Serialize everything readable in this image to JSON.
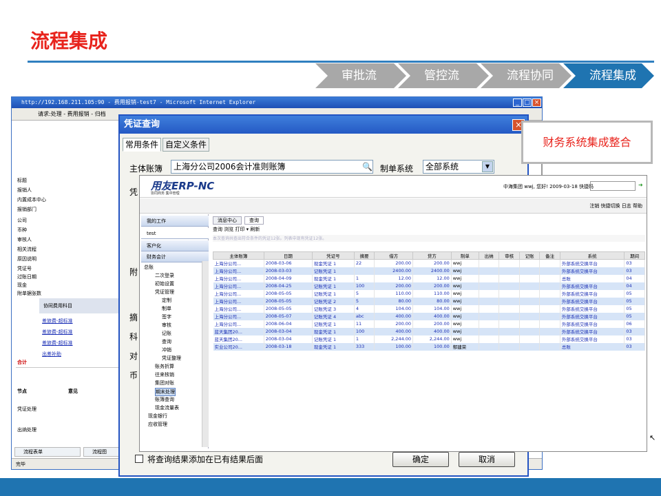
{
  "slide": {
    "title": "流程集成",
    "steps": [
      "审批流",
      "管控流",
      "流程协同",
      "流程集成"
    ],
    "callout": "财务系统集成整合"
  },
  "ie": {
    "title": "http://192.168.211.105:90 - 费用报销-test7 - Microsoft Internet Explorer",
    "toolbar": "请求:处理 - 费用报销 - 归档",
    "left_fields": [
      "标题",
      "报销人",
      "内置成本中心",
      "报销部门",
      "公司",
      "币种",
      "审核人",
      "相关流程",
      "原因说明",
      "凭证号",
      "过账日期",
      "现金",
      "附单据张数"
    ],
    "section_header": "协同费用科目",
    "section_links": [
      "差旅费-超标准",
      "差旅费-超标准",
      "差旅费-超标准",
      "出差补助"
    ],
    "total_label": "合计",
    "node_label": "节点",
    "opinion_label": "意见",
    "node_items": [
      "凭证处理",
      "出纳处理"
    ],
    "bottom_tabs": [
      "流程表单",
      "流程图"
    ],
    "status": "完毕"
  },
  "dialog": {
    "title": "凭证查询",
    "tabs": [
      "常用条件",
      "自定义条件"
    ],
    "ledger_label": "主体账簿",
    "ledger_value": "上海分公司2006会计准则账簿",
    "system_label": "制单系统",
    "system_value": "全部系统",
    "partial_labels": [
      "凭",
      "附",
      "摘",
      "科",
      "对",
      "币"
    ],
    "append_label": "将查询结果添加在已有结果后面",
    "ok_label": "确定",
    "cancel_label": "取消"
  },
  "erp": {
    "logo": "用友ERP-NC",
    "logo_sub": "协同商务   集中管理",
    "user_info": "中海集团 wwj, 您好! 2009-03-18   快捷码",
    "top_links": "注销  快捷切换  日志  帮助",
    "sidebar_headers": [
      "我的工作",
      "test",
      "客户化",
      "财务会计"
    ],
    "tree": [
      "总账",
      "二次登录",
      "初始设置",
      "凭证管理",
      "定制",
      "制单",
      "签字",
      "审核",
      "记账",
      "查询",
      "冲销",
      "凭证整理",
      "账务折算",
      "往来核销",
      "集团对账",
      "期末处理",
      "账簿查询",
      "现金流量表",
      "现金银行",
      "应收管理"
    ],
    "tabs": [
      "消息中心",
      "查询"
    ],
    "commands": "查询  浏览  打印 ▾  刷新",
    "info": "本次查询共查出符合条件的凭证12张。列表中现有凭证12张。",
    "columns": [
      "主体账簿",
      "日期",
      "凭证号",
      "摘要",
      "借方",
      "贷方",
      "制单",
      "出纳",
      "审核",
      "记账",
      "备注",
      "系统",
      "期间"
    ],
    "rows": [
      [
        "上海分公司...",
        "2008-03-06",
        "现金凭证 1",
        "22",
        "200.00",
        "200.00",
        "wwj",
        "",
        "",
        "",
        "",
        "外部系统交换平台",
        "03"
      ],
      [
        "上海分公司...",
        "2008-03-03",
        "记账凭证 1",
        "",
        "2400.00",
        "2400.00",
        "wwj",
        "",
        "",
        "",
        "",
        "外部系统交换平台",
        "03"
      ],
      [
        "上海分公司...",
        "2008-04-09",
        "现金凭证 1",
        "1",
        "12.00",
        "12.00",
        "wwj",
        "",
        "",
        "",
        "",
        "总账",
        "04"
      ],
      [
        "上海分公司...",
        "2008-04-25",
        "记账凭证 1",
        "100",
        "200.00",
        "200.00",
        "wwj",
        "",
        "",
        "",
        "",
        "外部系统交换平台",
        "04"
      ],
      [
        "上海分公司...",
        "2008-05-05",
        "记账凭证 1",
        "5",
        "110.00",
        "110.00",
        "wwj",
        "",
        "",
        "",
        "",
        "外部系统交换平台",
        "05"
      ],
      [
        "上海分公司...",
        "2008-05-05",
        "记账凭证 2",
        "5",
        "80.00",
        "80.00",
        "wwj",
        "",
        "",
        "",
        "",
        "外部系统交换平台",
        "05"
      ],
      [
        "上海分公司...",
        "2008-05-05",
        "记账凭证 3",
        "4",
        "104.00",
        "104.00",
        "wwj",
        "",
        "",
        "",
        "",
        "外部系统交换平台",
        "05"
      ],
      [
        "上海分公司...",
        "2008-05-07",
        "记账凭证 4",
        "abc",
        "400.00",
        "400.00",
        "wwj",
        "",
        "",
        "",
        "",
        "外部系统交换平台",
        "05"
      ],
      [
        "上海分公司...",
        "2008-06-04",
        "记账凭证 1",
        "11",
        "200.00",
        "200.00",
        "wwj",
        "",
        "",
        "",
        "",
        "外部系统交换平台",
        "06"
      ],
      [
        "蓝天集团20...",
        "2008-03-04",
        "现金凭证 1",
        "100",
        "400.00",
        "400.00",
        "wwj",
        "",
        "",
        "",
        "",
        "外部系统交换平台",
        "03"
      ],
      [
        "蓝天集团20...",
        "2008-03-04",
        "记账凭证 1",
        "1",
        "2,244.00",
        "2,244.00",
        "wwj",
        "",
        "",
        "",
        "",
        "外部系统交换平台",
        "03"
      ],
      [
        "实业公司20...",
        "2008-03-18",
        "现金凭证 1",
        "333",
        "100.00",
        "100.00",
        "郁建荣",
        "",
        "",
        "",
        "",
        "总账",
        "03"
      ]
    ]
  },
  "colors": {
    "title_red": "#e8231c",
    "rule_blue": "#2f7fc0",
    "step_gray": "#a5a5a5",
    "step_active": "#1f74b1"
  }
}
